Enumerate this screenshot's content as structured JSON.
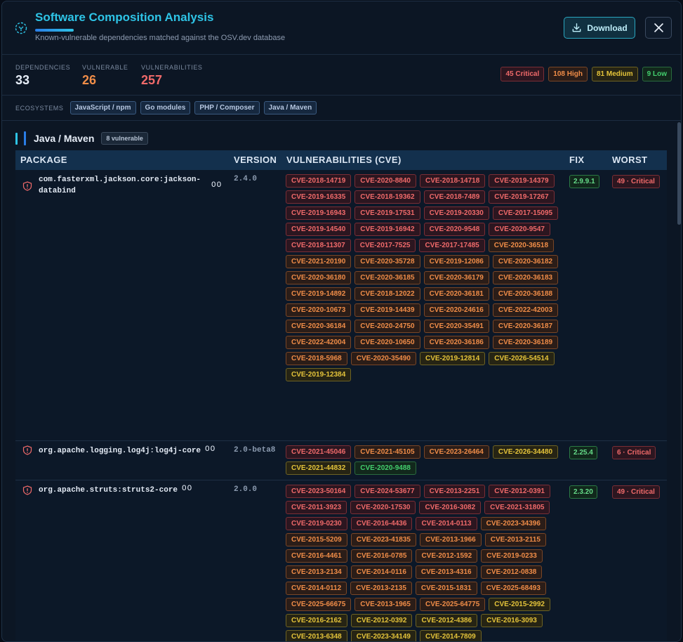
{
  "header": {
    "title": "Software Composition Analysis",
    "subtitle": "Known-vulnerable dependencies matched against the OSV.dev database",
    "download_label": "Download"
  },
  "stats": {
    "dependencies_label": "DEPENDENCIES",
    "dependencies_value": "33",
    "vulnerable_label": "VULNERABLE",
    "vulnerable_value": "26",
    "vulnerabilities_label": "VULNERABILITIES",
    "vulnerabilities_value": "257",
    "severity": {
      "critical": "45 Critical",
      "high": "108 High",
      "medium": "81 Medium",
      "low": "9 Low"
    }
  },
  "ecosystems": {
    "label": "ECOSYSTEMS",
    "items": [
      "JavaScript / npm",
      "Go modules",
      "PHP / Composer",
      "Java / Maven"
    ]
  },
  "group": {
    "name": "Java / Maven",
    "badge": "8 vulnerable"
  },
  "table": {
    "headers": [
      "PACKAGE",
      "VERSION",
      "VULNERABILITIES (CVE)",
      "FIX",
      "WORST"
    ],
    "rows": [
      {
        "package": "com.fasterxml.jackson.core:jackson-databind",
        "suffix": "OO",
        "version": "2.4.0",
        "fix": "2.9.9.1",
        "worst": "49 · Critical",
        "cves": [
          [
            "CVE-2018-14719",
            "crit"
          ],
          [
            "CVE-2020-8840",
            "crit"
          ],
          [
            "CVE-2018-14718",
            "crit"
          ],
          [
            "CVE-2019-14379",
            "crit"
          ],
          [
            "CVE-2019-16335",
            "crit"
          ],
          [
            "CVE-2018-19362",
            "crit"
          ],
          [
            "CVE-2018-7489",
            "crit"
          ],
          [
            "CVE-2019-17267",
            "crit"
          ],
          [
            "CVE-2019-16943",
            "crit"
          ],
          [
            "CVE-2019-17531",
            "crit"
          ],
          [
            "CVE-2019-20330",
            "crit"
          ],
          [
            "CVE-2017-15095",
            "crit"
          ],
          [
            "CVE-2019-14540",
            "crit"
          ],
          [
            "CVE-2019-16942",
            "crit"
          ],
          [
            "CVE-2020-9548",
            "crit"
          ],
          [
            "CVE-2020-9547",
            "crit"
          ],
          [
            "CVE-2018-11307",
            "crit"
          ],
          [
            "CVE-2017-7525",
            "crit"
          ],
          [
            "CVE-2017-17485",
            "crit"
          ],
          [
            "CVE-2020-36518",
            "high"
          ],
          [
            "CVE-2021-20190",
            "high"
          ],
          [
            "CVE-2020-35728",
            "high"
          ],
          [
            "CVE-2019-12086",
            "high"
          ],
          [
            "CVE-2020-36182",
            "high"
          ],
          [
            "CVE-2020-36180",
            "high"
          ],
          [
            "CVE-2020-36185",
            "high"
          ],
          [
            "CVE-2020-36179",
            "high"
          ],
          [
            "CVE-2020-36183",
            "high"
          ],
          [
            "CVE-2019-14892",
            "high"
          ],
          [
            "CVE-2018-12022",
            "high"
          ],
          [
            "CVE-2020-36181",
            "high"
          ],
          [
            "CVE-2020-36188",
            "high"
          ],
          [
            "CVE-2020-10673",
            "high"
          ],
          [
            "CVE-2019-14439",
            "high"
          ],
          [
            "CVE-2020-24616",
            "high"
          ],
          [
            "CVE-2022-42003",
            "high"
          ],
          [
            "CVE-2020-36184",
            "high"
          ],
          [
            "CVE-2020-24750",
            "high"
          ],
          [
            "CVE-2020-35491",
            "high"
          ],
          [
            "CVE-2020-36187",
            "high"
          ],
          [
            "CVE-2022-42004",
            "high"
          ],
          [
            "CVE-2020-10650",
            "high"
          ],
          [
            "CVE-2020-36186",
            "high"
          ],
          [
            "CVE-2020-36189",
            "high"
          ],
          [
            "CVE-2018-5968",
            "high"
          ],
          [
            "CVE-2020-35490",
            "high"
          ],
          [
            "CVE-2019-12814",
            "med"
          ],
          [
            "CVE-2026-54514",
            "med"
          ],
          [
            "CVE-2019-12384",
            "med"
          ]
        ]
      },
      {
        "package": "org.apache.logging.log4j:log4j-core",
        "suffix": "OO",
        "version": "2.0-beta8",
        "fix": "2.25.4",
        "worst": "6 · Critical",
        "cves": [
          [
            "CVE-2021-45046",
            "crit"
          ],
          [
            "CVE-2021-45105",
            "high"
          ],
          [
            "CVE-2023-26464",
            "high"
          ],
          [
            "CVE-2026-34480",
            "med"
          ],
          [
            "CVE-2021-44832",
            "med"
          ],
          [
            "CVE-2020-9488",
            "low"
          ]
        ]
      },
      {
        "package": "org.apache.struts:struts2-core",
        "suffix": "OO",
        "version": "2.0.0",
        "fix": "2.3.20",
        "worst": "49 · Critical",
        "cves": [
          [
            "CVE-2023-50164",
            "crit"
          ],
          [
            "CVE-2024-53677",
            "crit"
          ],
          [
            "CVE-2013-2251",
            "crit"
          ],
          [
            "CVE-2012-0391",
            "crit"
          ],
          [
            "CVE-2011-3923",
            "crit"
          ],
          [
            "CVE-2020-17530",
            "crit"
          ],
          [
            "CVE-2016-3082",
            "crit"
          ],
          [
            "CVE-2021-31805",
            "crit"
          ],
          [
            "CVE-2019-0230",
            "crit"
          ],
          [
            "CVE-2016-4436",
            "crit"
          ],
          [
            "CVE-2014-0113",
            "crit"
          ],
          [
            "CVE-2023-34396",
            "high"
          ],
          [
            "CVE-2015-5209",
            "high"
          ],
          [
            "CVE-2023-41835",
            "high"
          ],
          [
            "CVE-2013-1966",
            "high"
          ],
          [
            "CVE-2013-2115",
            "high"
          ],
          [
            "CVE-2016-4461",
            "high"
          ],
          [
            "CVE-2016-0785",
            "high"
          ],
          [
            "CVE-2012-1592",
            "high"
          ],
          [
            "CVE-2019-0233",
            "high"
          ],
          [
            "CVE-2013-2134",
            "high"
          ],
          [
            "CVE-2014-0116",
            "high"
          ],
          [
            "CVE-2013-4316",
            "high"
          ],
          [
            "CVE-2012-0838",
            "high"
          ],
          [
            "CVE-2014-0112",
            "high"
          ],
          [
            "CVE-2013-2135",
            "high"
          ],
          [
            "CVE-2015-1831",
            "high"
          ],
          [
            "CVE-2025-68493",
            "high"
          ],
          [
            "CVE-2025-66675",
            "high"
          ],
          [
            "CVE-2013-1965",
            "high"
          ],
          [
            "CVE-2025-64775",
            "high"
          ],
          [
            "CVE-2015-2992",
            "med"
          ],
          [
            "CVE-2016-2162",
            "med"
          ],
          [
            "CVE-2012-0392",
            "med"
          ],
          [
            "CVE-2012-4386",
            "med"
          ],
          [
            "CVE-2016-3093",
            "med"
          ],
          [
            "CVE-2013-6348",
            "med"
          ],
          [
            "CVE-2023-34149",
            "med"
          ],
          [
            "CVE-2014-7809",
            "med"
          ]
        ]
      }
    ]
  },
  "colors": {
    "accent": "#2ec4e6",
    "critical": "#f06a6a",
    "high": "#f08d48",
    "medium": "#e5c43a",
    "low": "#43cf6e"
  }
}
